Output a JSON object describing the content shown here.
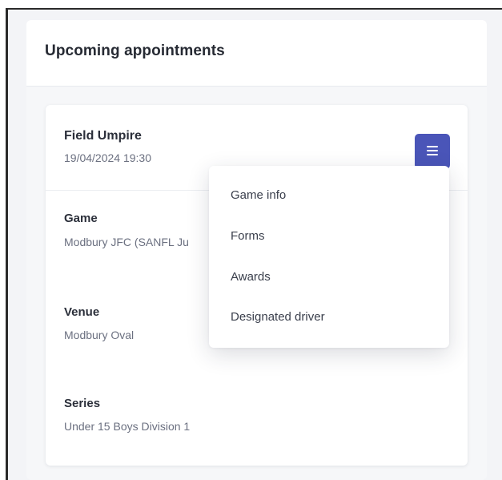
{
  "panel": {
    "title": "Upcoming appointments"
  },
  "appointment": {
    "role": "Field Umpire",
    "datetime": "19/04/2024 19:30",
    "menu_icon": "hamburger-menu-icon",
    "fields": [
      {
        "label": "Game",
        "value": "Modbury JFC (SANFL Ju"
      },
      {
        "label": "Venue",
        "value": "Modbury Oval"
      },
      {
        "label": "Series",
        "value": "Under 15 Boys Division 1"
      }
    ]
  },
  "dropdown": {
    "items": [
      {
        "label": "Game info"
      },
      {
        "label": "Forms"
      },
      {
        "label": "Awards"
      },
      {
        "label": "Designated driver"
      }
    ]
  },
  "colors": {
    "accent": "#4a55b8",
    "page_background": "#f3f4f7",
    "card_background": "#ffffff"
  }
}
